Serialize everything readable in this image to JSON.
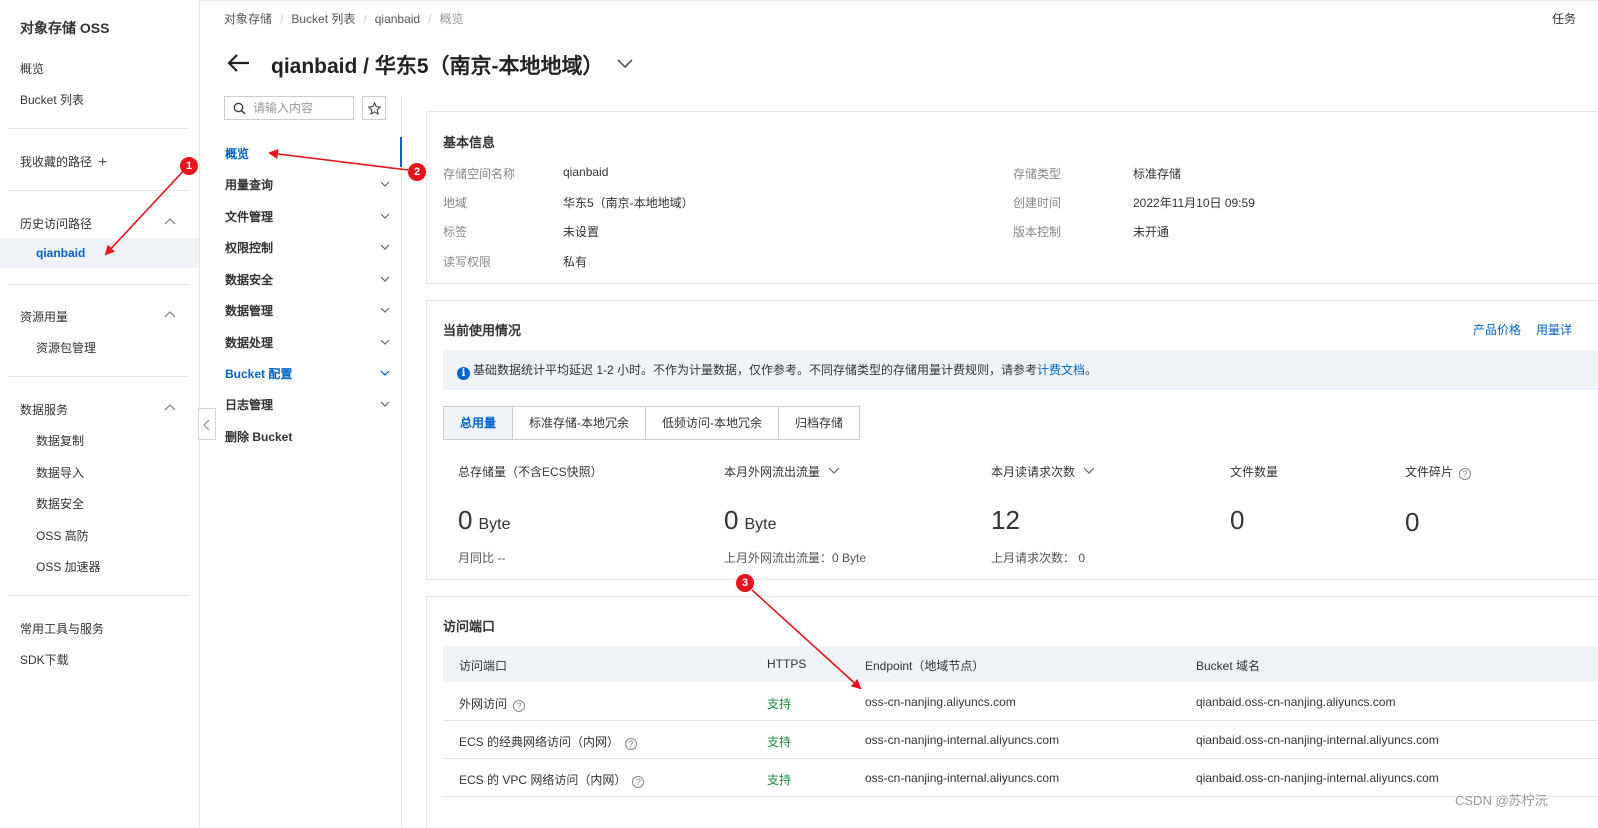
{
  "leftnav": {
    "title": "对象存储 OSS",
    "overview": "概览",
    "bucket_list": "Bucket 列表",
    "favorites": "我收藏的路径",
    "history": "历史访问路径",
    "history_item": "qianbaid",
    "resources": "资源用量",
    "resource_pkg": "资源包管理",
    "data_services": "数据服务",
    "data_services_items": [
      "数据复制",
      "数据导入",
      "数据安全",
      "OSS 高防",
      "OSS 加速器"
    ],
    "tools": "常用工具与服务",
    "sdk": "SDK下载"
  },
  "breadcrumb": [
    "对象存储",
    "Bucket 列表",
    "qianbaid",
    "概览"
  ],
  "top_right": "任务",
  "header": {
    "title": "qianbaid / 华东5（南京-本地地域）"
  },
  "subnav": {
    "search_placeholder": "请输入内容",
    "items": [
      "概览",
      "用量查询",
      "文件管理",
      "权限控制",
      "数据安全",
      "数据管理",
      "数据处理",
      "Bucket 配置",
      "日志管理",
      "删除 Bucket"
    ]
  },
  "basic": {
    "title": "基本信息",
    "rows": [
      {
        "label": "存储空间名称",
        "value": "qianbaid"
      },
      {
        "label": "地域",
        "value": "华东5（南京-本地地域）"
      },
      {
        "label": "标签",
        "value": "未设置"
      },
      {
        "label": "读写权限",
        "value": "私有"
      }
    ],
    "rows_right": [
      {
        "label": "存储类型",
        "value": "标准存储"
      },
      {
        "label": "创建时间",
        "value": "2022年11月10日 09:59"
      },
      {
        "label": "版本控制",
        "value": "未开通"
      }
    ]
  },
  "usage": {
    "title": "当前使用情况",
    "link_price": "产品价格",
    "link_detail": "用量详",
    "notice_text": "基础数据统计平均延迟 1-2 小时。不作为计量数据，仅作参考。不同存储类型的存储用量计费规则，请参考",
    "notice_link": "计费文档",
    "notice_end": "。",
    "tabs": [
      "总用量",
      "标准存储-本地冗余",
      "低频访问-本地冗余",
      "归档存储"
    ],
    "metrics": [
      {
        "label": "总存储量（不含ECS快照）",
        "value": "0",
        "unit": "Byte",
        "sub": "月同比  --"
      },
      {
        "label": "本月外网流出流量",
        "value": "0",
        "unit": "Byte",
        "sub": "上月外网流出流量：0 Byte"
      },
      {
        "label": "本月读请求次数",
        "value": "12",
        "unit": "",
        "sub": "上月请求次数：  0"
      },
      {
        "label": "文件数量",
        "value": "0",
        "unit": "",
        "sub": ""
      },
      {
        "label": "文件碎片",
        "value": "0",
        "unit": "",
        "sub": ""
      }
    ]
  },
  "access": {
    "title": "访问端口",
    "headers": [
      "访问端口",
      "HTTPS",
      "Endpoint（地域节点）",
      "Bucket 域名"
    ],
    "rows": [
      {
        "port": "外网访问",
        "https": "支持",
        "endpoint": "oss-cn-nanjing.aliyuncs.com",
        "domain": "qianbaid.oss-cn-nanjing.aliyuncs.com"
      },
      {
        "port": "ECS 的经典网络访问（内网）",
        "https": "支持",
        "endpoint": "oss-cn-nanjing-internal.aliyuncs.com",
        "domain": "qianbaid.oss-cn-nanjing-internal.aliyuncs.com"
      },
      {
        "port": "ECS 的 VPC 网络访问（内网）",
        "https": "支持",
        "endpoint": "oss-cn-nanjing-internal.aliyuncs.com",
        "domain": "qianbaid.oss-cn-nanjing-internal.aliyuncs.com"
      }
    ]
  },
  "annotations": [
    "1",
    "2",
    "3"
  ],
  "watermark": "CSDN @苏柠沅",
  "colors": {
    "accent": "#0064c8",
    "annotation": "#e5141d",
    "support_green": "#1e8e3e"
  }
}
